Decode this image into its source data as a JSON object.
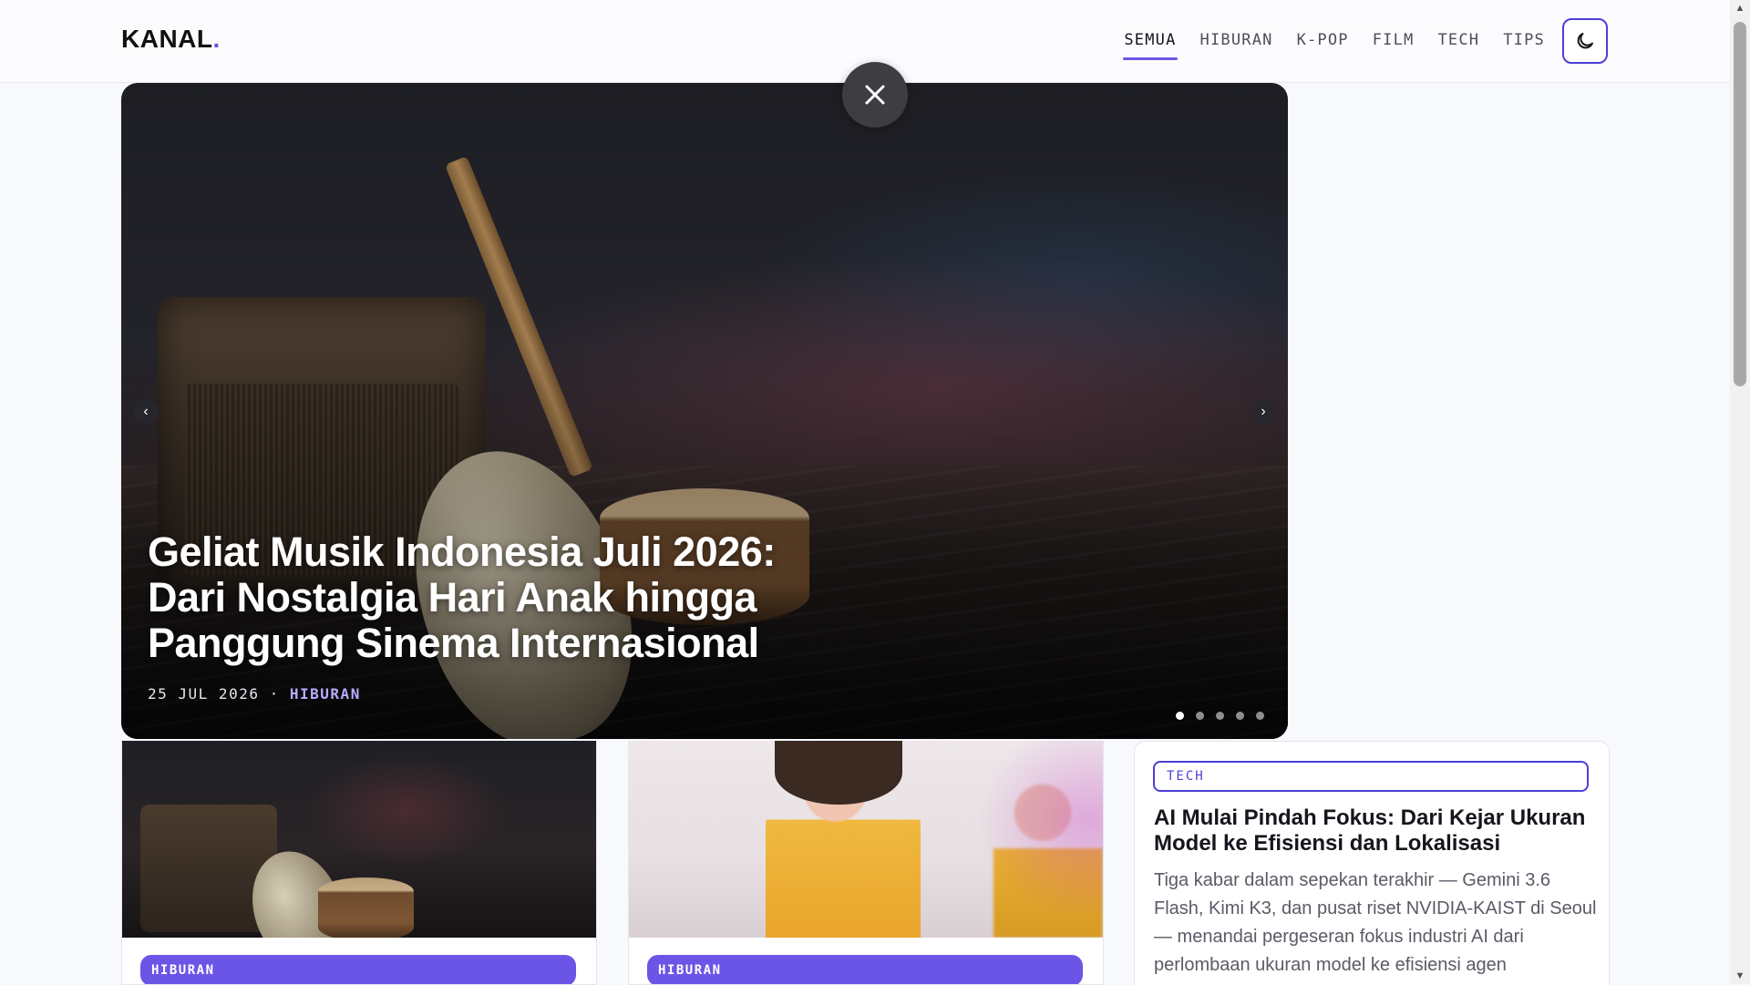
{
  "header": {
    "logo_text": "KANAL",
    "logo_dot": ".",
    "nav": [
      "SEMUA",
      "HIBURAN",
      "K-POP",
      "FILM",
      "TECH",
      "TIPS"
    ],
    "active_nav": "SEMUA",
    "theme_toggle_icon": "moon-icon"
  },
  "hero": {
    "title": "Geliat Musik Indonesia Juli 2026: Dari Nostalgia Hari Anak hingga Panggung Sinema Internasional",
    "date": "25 JUL 2026",
    "separator": "·",
    "category": "HIBURAN",
    "prev_glyph": "‹",
    "next_glyph": "›",
    "slide_count": 5,
    "active_slide": 1,
    "close_icon": "close-icon"
  },
  "cards": [
    {
      "category": "HIBURAN",
      "image": "guitar-amp-stage"
    },
    {
      "category": "HIBURAN",
      "image": "idol-performers-stage"
    }
  ],
  "tech_card": {
    "category": "TECH",
    "title": "AI Mulai Pindah Fokus: Dari Kejar Ukuran Model ke Efisiensi dan Lokalisasi",
    "description": "Tiga kabar dalam sepekan terakhir — Gemini 3.6 Flash, Kimi K3, dan pusat riset NVIDIA-KAIST di Seoul — menandai pergeseran fokus industri AI dari perlombaan ukuran model ke efisiensi agen"
  },
  "colors": {
    "accent": "#6a55e6",
    "accent_dark": "#4e3fd6",
    "close_bg": "#3d3d42"
  }
}
